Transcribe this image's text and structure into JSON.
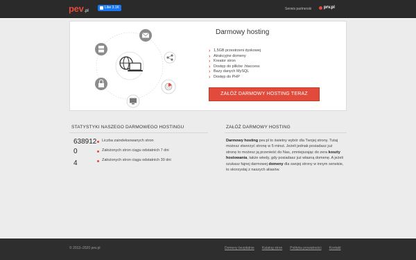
{
  "header": {
    "logo_text": "pev",
    "logo_suffix": ".pl",
    "fb_like_label": "Like 3.1K",
    "partners_label": "Serwis partnerski",
    "partner_logo": "prv.pl"
  },
  "hero": {
    "title": "Darmowy hosting",
    "features": [
      "1,5GB przestrzeni dyskowej",
      "Atrakcyjne domeny",
      "Kreator stron",
      "Dostęp do plików .htaccess",
      "Bazy danych MySQL",
      "Dostęp do PHP"
    ],
    "cta_label": "ZAŁÓŻ DARMOWY HOSTING TERAZ",
    "illustration_icons": [
      "mail-icon",
      "server-icon",
      "lock-icon",
      "monitor-icon",
      "chart-icon",
      "share-icon",
      "globe-laptop-icon"
    ]
  },
  "stats": {
    "title": "STATYSTYKI NASZEGO DARMOWEGO HOSTINGU",
    "items": [
      {
        "value": "638912",
        "label": "Liczba zaindeksowanych stron"
      },
      {
        "value": "0",
        "label": "Założonych stron ciągu odstatnich 7 dni"
      },
      {
        "value": "4",
        "label": "Założonych stron ciągu odstatnich 30 dni"
      }
    ]
  },
  "about": {
    "title": "ZAŁÓŻ DARMOWY HOSTING",
    "bold_1": "Darmowy hosting",
    "text_1": " pev.pl to świetny wybór dla Twojej strony. Tutaj możesz stworzyć stronę w 5 minut. Jeżeli jednak posiadasz już stronę to możesz ją przenieść do Nas, zmniejszając do zera ",
    "bold_2": "koszty hostowania",
    "text_2": ", także wtedy, gdy posiadasz już własną domenę. A jeżeli szukasz fajnej darmowej ",
    "bold_3": "domeny",
    "text_3": " dla swojej strony w innym serwisie, to skorzystaj z naszych aliasów."
  },
  "footer": {
    "copyright": "© 2013–2020 pev.pl",
    "links": [
      "Domeny bezpłatnie",
      "Katalog stron",
      "Polityka prywatności",
      "Kontakt"
    ]
  },
  "colors": {
    "accent": "#e24b3b",
    "topbar": "#2a2a2a",
    "footer": "#2e2e2e",
    "page_bg": "#ececec"
  }
}
